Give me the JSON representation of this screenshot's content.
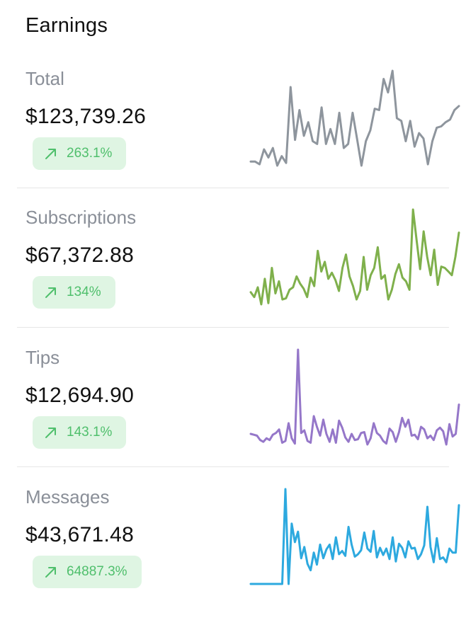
{
  "header": {
    "title": "Earnings"
  },
  "cards": [
    {
      "label": "Total",
      "value": "$123,739.26",
      "change": "263.1%",
      "trend_icon": "arrow-up-right-icon",
      "color": "#8e959d",
      "series": [
        18,
        18,
        16,
        27,
        21,
        28,
        15,
        22,
        17,
        73,
        34,
        56,
        37,
        47,
        33,
        31,
        58,
        31,
        42,
        31,
        54,
        28,
        31,
        54,
        35,
        15,
        33,
        41,
        57,
        56,
        79,
        69,
        85,
        50,
        48,
        33,
        48,
        29,
        39,
        35,
        16,
        33,
        43,
        44,
        47,
        49,
        56,
        59
      ]
    },
    {
      "label": "Subscriptions",
      "value": "$67,372.88",
      "change": "134%",
      "trend_icon": "arrow-up-right-icon",
      "color": "#7fb04c",
      "series": [
        18,
        14,
        22,
        8,
        29,
        9,
        38,
        17,
        27,
        12,
        13,
        20,
        22,
        31,
        25,
        21,
        14,
        30,
        23,
        52,
        35,
        43,
        29,
        34,
        28,
        19,
        38,
        49,
        31,
        23,
        12,
        19,
        47,
        20,
        32,
        38,
        55,
        29,
        32,
        12,
        20,
        33,
        41,
        30,
        27,
        20,
        86,
        61,
        37,
        68,
        47,
        32,
        53,
        24,
        39,
        38,
        35,
        32,
        47,
        67
      ]
    },
    {
      "label": "Tips",
      "value": "$12,694.90",
      "change": "143.1%",
      "trend_icon": "arrow-up-right-icon",
      "color": "#9577c9",
      "series": [
        19,
        18,
        17,
        12,
        10,
        14,
        12,
        18,
        20,
        24,
        9,
        11,
        31,
        14,
        8,
        114,
        20,
        23,
        11,
        9,
        39,
        27,
        17,
        35,
        19,
        10,
        24,
        9,
        34,
        26,
        15,
        10,
        19,
        12,
        13,
        20,
        21,
        7,
        14,
        31,
        20,
        17,
        11,
        8,
        25,
        21,
        10,
        21,
        37,
        27,
        35,
        17,
        18,
        13,
        27,
        24,
        14,
        17,
        12,
        23,
        26,
        22,
        7,
        30,
        16,
        19,
        52
      ]
    },
    {
      "label": "Messages",
      "value": "$43,671.48",
      "change": "64887.3%",
      "trend_icon": "arrow-up-right-icon",
      "color": "#2da9df",
      "series": [
        0,
        0,
        0,
        0,
        0,
        0,
        0,
        0,
        0,
        0,
        0,
        118,
        0,
        75,
        52,
        65,
        32,
        46,
        25,
        17,
        39,
        24,
        49,
        32,
        43,
        49,
        31,
        58,
        37,
        41,
        35,
        71,
        49,
        34,
        37,
        42,
        64,
        44,
        40,
        66,
        33,
        45,
        36,
        44,
        31,
        58,
        28,
        50,
        45,
        33,
        53,
        44,
        45,
        31,
        37,
        48,
        96,
        46,
        27,
        57,
        31,
        33,
        27,
        44,
        39,
        39,
        98
      ]
    }
  ]
}
